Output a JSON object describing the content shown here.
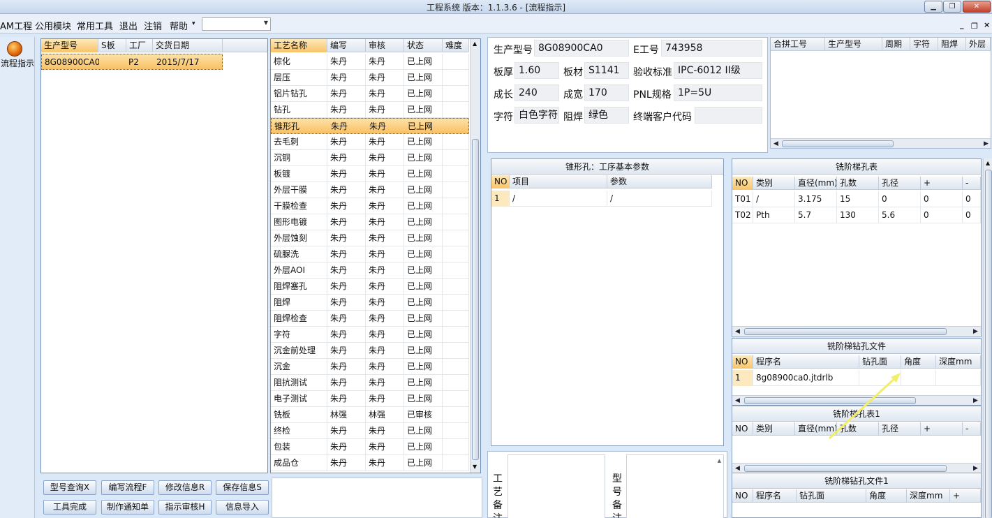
{
  "window": {
    "title": "工程系统   版本：1.1.3.6 - [流程指示]"
  },
  "menu": {
    "items": [
      "AM工程",
      "公用模块",
      "常用工具",
      "退出",
      "注销",
      "帮助"
    ],
    "help_arrow": "▾",
    "combo_value": ""
  },
  "mdi": {
    "minimize": "_",
    "restore": "❐",
    "close": "×"
  },
  "sidebar": {
    "flow_label": "流程指示",
    "icon": "power-indicator-icon"
  },
  "orders": {
    "headers": [
      "生产型号",
      "S板",
      "工厂",
      "交货日期"
    ],
    "rows": [
      {
        "model": "8G08900CA0",
        "s": "",
        "factory": "P2",
        "date": "2015/7/17"
      }
    ]
  },
  "process": {
    "headers": [
      "工艺名称",
      "编写",
      "审核",
      "状态",
      "难度"
    ],
    "rows": [
      [
        "棕化",
        "朱丹",
        "朱丹",
        "已上网",
        ""
      ],
      [
        "层压",
        "朱丹",
        "朱丹",
        "已上网",
        ""
      ],
      [
        "铝片钻孔",
        "朱丹",
        "朱丹",
        "已上网",
        ""
      ],
      [
        "钻孔",
        "朱丹",
        "朱丹",
        "已上网",
        ""
      ],
      [
        "锥形孔",
        "朱丹",
        "朱丹",
        "已上网",
        ""
      ],
      [
        "去毛刺",
        "朱丹",
        "朱丹",
        "已上网",
        ""
      ],
      [
        "沉铜",
        "朱丹",
        "朱丹",
        "已上网",
        ""
      ],
      [
        "板镀",
        "朱丹",
        "朱丹",
        "已上网",
        ""
      ],
      [
        "外层干膜",
        "朱丹",
        "朱丹",
        "已上网",
        ""
      ],
      [
        "干膜检查",
        "朱丹",
        "朱丹",
        "已上网",
        ""
      ],
      [
        "图形电镀",
        "朱丹",
        "朱丹",
        "已上网",
        ""
      ],
      [
        "外层蚀刻",
        "朱丹",
        "朱丹",
        "已上网",
        ""
      ],
      [
        "硫脲洗",
        "朱丹",
        "朱丹",
        "已上网",
        ""
      ],
      [
        "外层AOI",
        "朱丹",
        "朱丹",
        "已上网",
        ""
      ],
      [
        "阻焊塞孔",
        "朱丹",
        "朱丹",
        "已上网",
        ""
      ],
      [
        "阻焊",
        "朱丹",
        "朱丹",
        "已上网",
        ""
      ],
      [
        "阻焊检查",
        "朱丹",
        "朱丹",
        "已上网",
        ""
      ],
      [
        "字符",
        "朱丹",
        "朱丹",
        "已上网",
        ""
      ],
      [
        "沉金前处理",
        "朱丹",
        "朱丹",
        "已上网",
        ""
      ],
      [
        "沉金",
        "朱丹",
        "朱丹",
        "已上网",
        ""
      ],
      [
        "阻抗测试",
        "朱丹",
        "朱丹",
        "已上网",
        ""
      ],
      [
        "电子测试",
        "朱丹",
        "朱丹",
        "已上网",
        ""
      ],
      [
        "铣板",
        "林强",
        "林强",
        "已审核",
        ""
      ],
      [
        "终检",
        "朱丹",
        "朱丹",
        "已上网",
        ""
      ],
      [
        "包装",
        "朱丹",
        "朱丹",
        "已上网",
        ""
      ],
      [
        "成品仓",
        "朱丹",
        "朱丹",
        "已上网",
        ""
      ]
    ],
    "selected_index": 4
  },
  "buttons": {
    "row1": [
      "型号查询X",
      "编写流程F",
      "修改信息R",
      "保存信息S"
    ],
    "row2": [
      "工具完成",
      "制作通知单",
      "指示审核H",
      "信息导入"
    ]
  },
  "info": {
    "model_label": "生产型号",
    "model_value": "8G08900CA0",
    "eno_label": "E工号",
    "eno_value": "743958",
    "thickness_label": "板厚",
    "thickness_value": "1.60",
    "material_label": "板材",
    "material_value": "S1141",
    "standard_label": "验收标准",
    "standard_value": "IPC-6012 II级",
    "length_label": "成长",
    "length_value": "240",
    "width_label": "成宽",
    "width_value": "170",
    "pnl_label": "PNL规格",
    "pnl_value": "1P=5U",
    "char_label": "字符",
    "char_value": "白色字符",
    "mask_label": "阻焊",
    "mask_value": "绿色",
    "customer_label": "终端客户代码",
    "customer_value": ""
  },
  "merge": {
    "headers": [
      "合拼工号",
      "生产型号",
      "周期",
      "字符",
      "阻焊",
      "外层"
    ]
  },
  "params": {
    "title": "锥形孔：工序基本参数",
    "headers": [
      "NO",
      "项目",
      "参数"
    ],
    "rows": [
      [
        "1",
        "/",
        "/"
      ]
    ]
  },
  "notes": {
    "process_label": [
      "工",
      "艺",
      "备",
      "注"
    ],
    "model_label": [
      "型",
      "号",
      "备",
      "注"
    ]
  },
  "step_holes": {
    "title": "铣阶梯孔表",
    "headers": [
      "NO",
      "类别",
      "直径(mm)",
      "孔数",
      "孔径",
      "+",
      "-"
    ],
    "rows": [
      [
        "T01",
        "/",
        "3.175",
        "15",
        "0",
        "0",
        "0"
      ],
      [
        "T02",
        "Pth",
        "5.7",
        "130",
        "5.6",
        "0",
        "0"
      ]
    ]
  },
  "step_files": {
    "title": "铣阶梯钻孔文件",
    "headers": [
      "NO",
      "程序名",
      "钻孔面",
      "角度",
      "深度mm"
    ],
    "rows": [
      [
        "1",
        "8g08900ca0.jtdrlb",
        "",
        "",
        ""
      ]
    ]
  },
  "step_holes1": {
    "title": "铣阶梯孔表1",
    "headers": [
      "NO",
      "类别",
      "直径(mm)",
      "孔数",
      "孔径",
      "+",
      "-"
    ]
  },
  "step_files1": {
    "title": "铣阶梯钻孔文件1",
    "headers": [
      "NO",
      "程序名",
      "钻孔面",
      "角度",
      "深度mm",
      "+"
    ]
  }
}
